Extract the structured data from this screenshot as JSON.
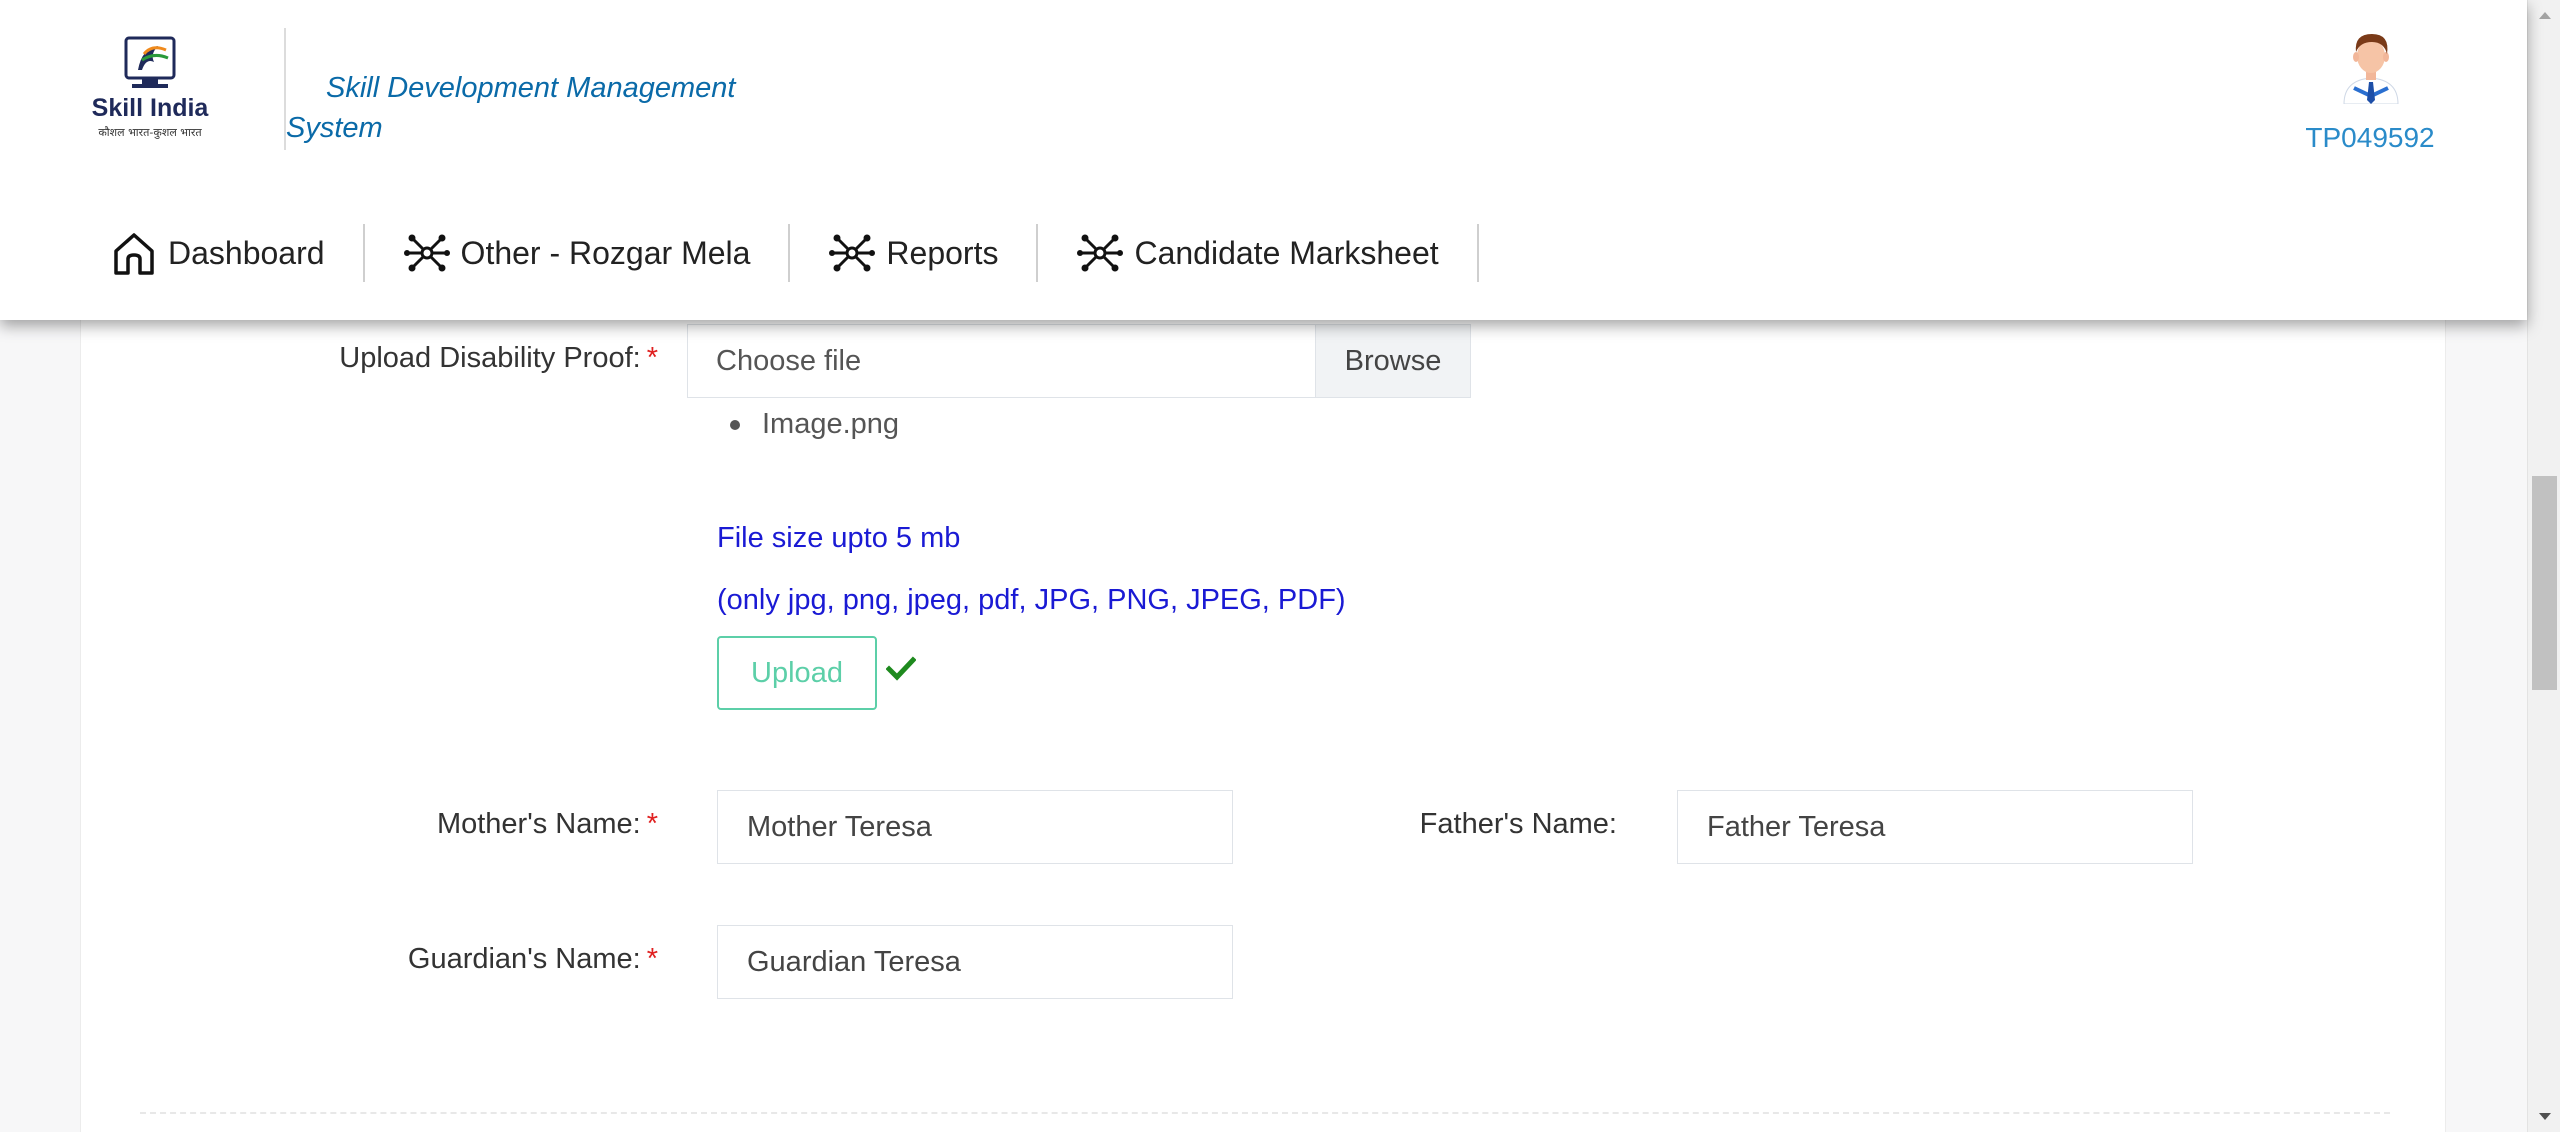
{
  "app": {
    "logo_text": "Skill India",
    "logo_tagline": "कौशल भारत-कुशल भारत",
    "title_line1": "Skill Development Management",
    "title_line2": "System",
    "user_id": "TP049592"
  },
  "nav": {
    "items": [
      {
        "label": "Dashboard",
        "icon": "home-icon"
      },
      {
        "label": "Other - Rozgar Mela",
        "icon": "network-icon"
      },
      {
        "label": "Reports",
        "icon": "network-icon"
      },
      {
        "label": "Candidate Marksheet",
        "icon": "network-icon"
      }
    ]
  },
  "form": {
    "disability_proof": {
      "label": "Upload Disability Proof:",
      "required_mark": "*",
      "placeholder": "Choose file",
      "browse_label": "Browse",
      "uploaded_files": [
        "Image.png"
      ],
      "size_hint": "File size upto 5 mb",
      "type_hint": "(only jpg, png, jpeg, pdf, JPG, PNG, JPEG, PDF)",
      "upload_label": "Upload",
      "upload_status_icon": "check-icon"
    },
    "mother_name": {
      "label": "Mother's Name:",
      "required_mark": "*",
      "value": "Mother Teresa"
    },
    "father_name": {
      "label": "Father's Name:",
      "value": "Father Teresa"
    },
    "guardian_name": {
      "label": "Guardian's Name:",
      "required_mark": "*",
      "value": "Guardian Teresa"
    }
  },
  "colors": {
    "title_blue": "#0a6aa8",
    "user_id_blue": "#2a8bc9",
    "hint_blue": "#1a1ad4",
    "upload_green": "#5ccfa8",
    "check_green": "#1e8a1e",
    "required_red": "#e02020"
  }
}
